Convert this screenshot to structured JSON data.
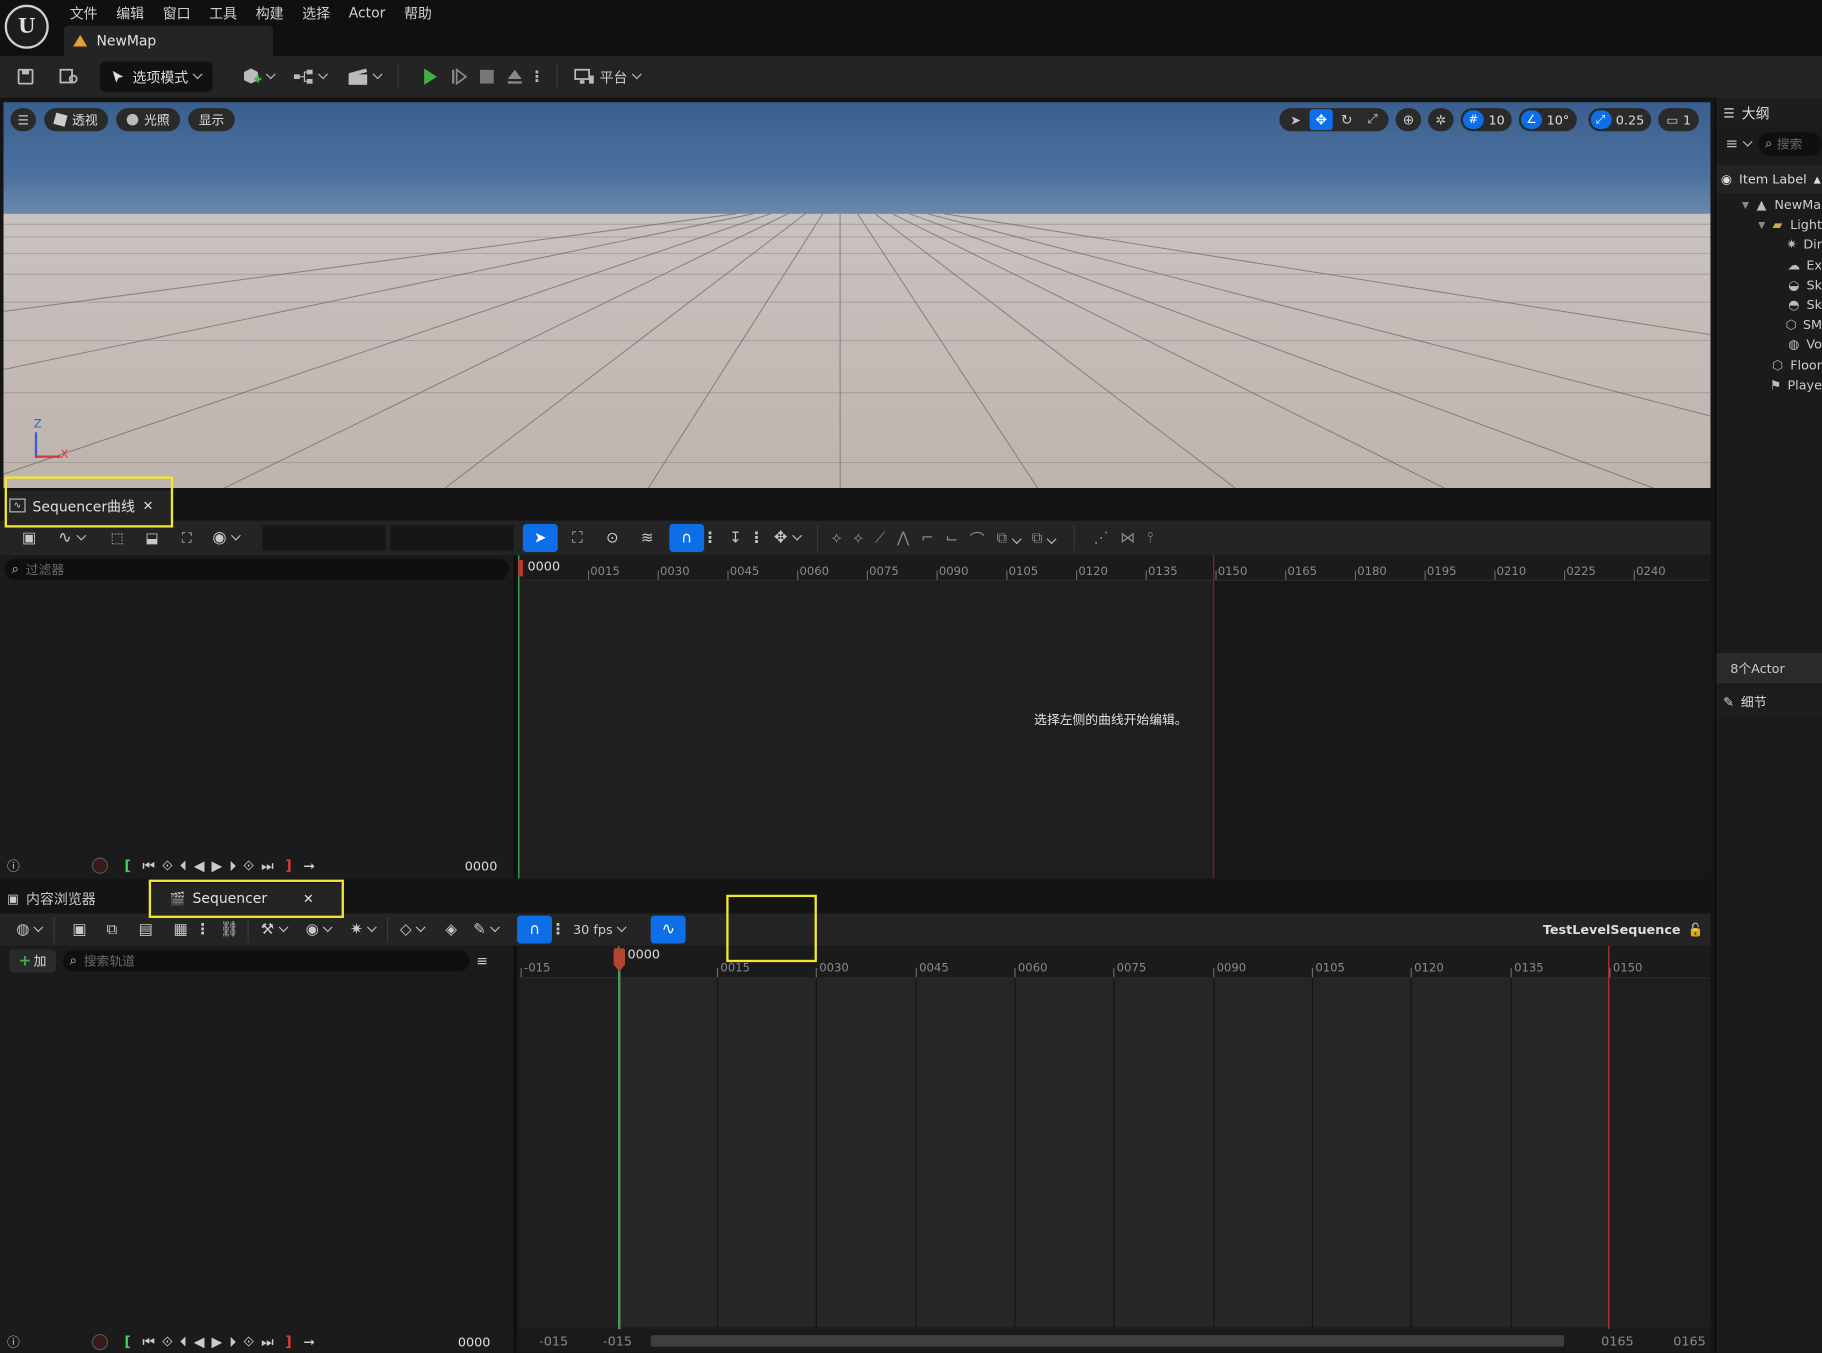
{
  "menu": {
    "items": [
      "文件",
      "编辑",
      "窗口",
      "工具",
      "构建",
      "选择",
      "Actor",
      "帮助"
    ]
  },
  "level_tab": {
    "label": "NewMap"
  },
  "main_toolbar": {
    "mode_label": "选项模式",
    "platform_label": "平台"
  },
  "viewport": {
    "perspective_label": "透视",
    "lighting_label": "光照",
    "show_label": "显示",
    "grid_snap": "10",
    "rotation_snap": "10°",
    "scale_snap": "0.25",
    "camera_speed": "1",
    "axis_z": "Z",
    "axis_x": "X"
  },
  "outliner": {
    "title": "大纲",
    "search_placeholder": "搜索",
    "column_label": "Item Label",
    "items": [
      {
        "label": "NewMa",
        "icon": "level-icon",
        "indent": 0
      },
      {
        "label": "Light",
        "icon": "folder-icon",
        "indent": 1
      },
      {
        "label": "Dir",
        "icon": "directional-light-icon",
        "indent": 2
      },
      {
        "label": "Ex",
        "icon": "fog-icon",
        "indent": 2
      },
      {
        "label": "Sk",
        "icon": "sky-atmosphere-icon",
        "indent": 2
      },
      {
        "label": "Sk",
        "icon": "sky-light-icon",
        "indent": 2
      },
      {
        "label": "SM",
        "icon": "static-mesh-icon",
        "indent": 2
      },
      {
        "label": "Vo",
        "icon": "volumetric-cloud-icon",
        "indent": 2
      },
      {
        "label": "Floor",
        "icon": "static-mesh-icon",
        "indent": 1
      },
      {
        "label": "Playe",
        "icon": "player-start-icon",
        "indent": 1
      }
    ],
    "actor_count": "8个Actor",
    "details_label": "细节"
  },
  "curve_editor": {
    "tab_label": "Sequencer曲线",
    "filter_placeholder": "过滤器",
    "empty_message": "选择左侧的曲线开始编辑。",
    "current_frame": "0000",
    "frame_display": "0000",
    "ruler_labels": [
      "0015",
      "0030",
      "0045",
      "0060",
      "0075",
      "0090",
      "0105",
      "0120",
      "0135",
      "0150",
      "0165",
      "0180",
      "0195",
      "0210",
      "0225",
      "0240"
    ]
  },
  "bottom_tabs": {
    "content_browser_label": "内容浏览器",
    "sequencer_label": "Sequencer"
  },
  "sequencer": {
    "fps_label": "30 fps",
    "sequence_name": "TestLevelSequence",
    "add_label": "加",
    "search_placeholder": "搜索轨道",
    "current_frame": "0000",
    "frame_display": "0000",
    "ruler_labels": [
      "-015",
      "0015",
      "0030",
      "0045",
      "0060",
      "0075",
      "0090",
      "0105",
      "0120",
      "0135",
      "0150"
    ],
    "range": {
      "view_start": "-015",
      "work_start": "-015",
      "view_end": "0165",
      "work_end": "0165"
    }
  },
  "colors": {
    "accent_blue": "#0e6ee8",
    "highlight_yellow": "#f2e62e",
    "play_green": "#43b045",
    "playhead_red": "#c0392b"
  }
}
